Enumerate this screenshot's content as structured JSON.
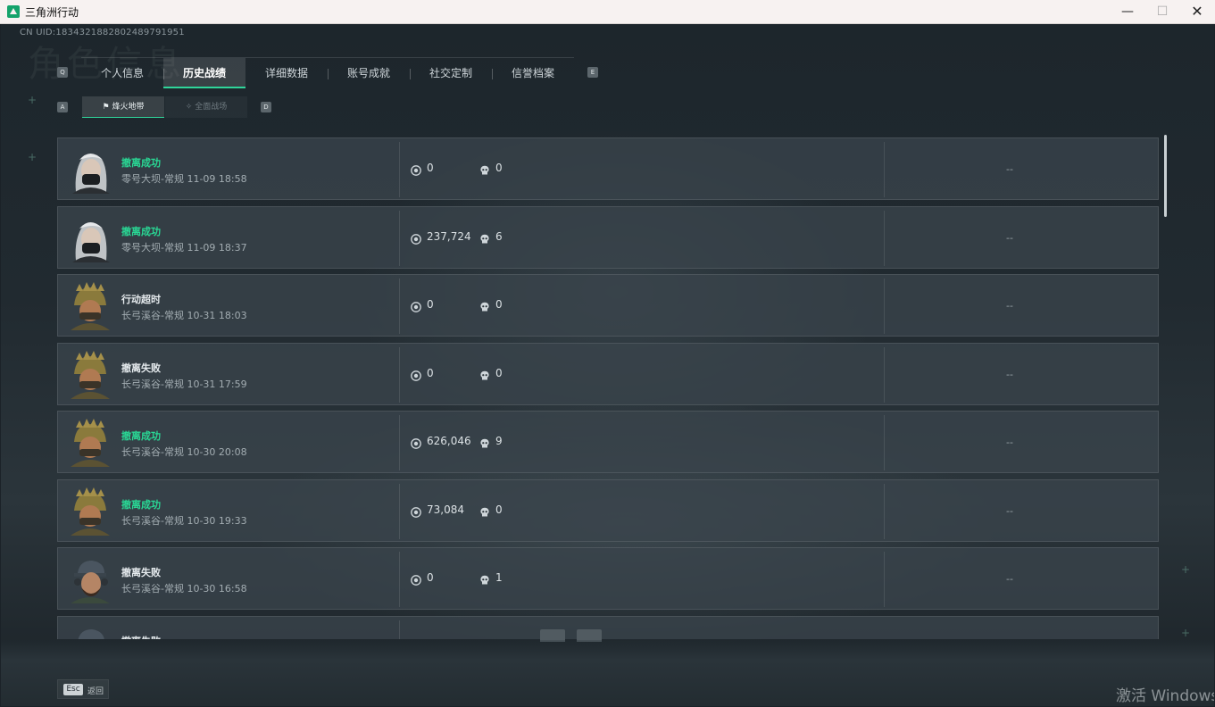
{
  "window": {
    "title": "三角洲行动",
    "controls": {
      "minimize": "—",
      "maximize": "☐",
      "close": "✕"
    }
  },
  "header": {
    "uid": "CN UID:1834321882802489791951",
    "watermark": "角色信息"
  },
  "tabs": {
    "left_key": "Q",
    "right_key": "E",
    "items": [
      {
        "label": "个人信息"
      },
      {
        "label": "历史战绩",
        "active": true
      },
      {
        "label": "详细数据"
      },
      {
        "label": "账号成就"
      },
      {
        "label": "社交定制"
      },
      {
        "label": "信誉档案"
      }
    ]
  },
  "subtabs": {
    "left_key": "A",
    "right_key": "D",
    "items": [
      {
        "label": "烽火地带",
        "active": true
      },
      {
        "label": "全面战场",
        "active": false
      }
    ]
  },
  "matches": [
    {
      "result": "撤离成功",
      "status": "success",
      "map": "零号大坝-常规 11-09 18:58",
      "value": "0",
      "kills": "0",
      "extra": "--",
      "avatar": "female-mask"
    },
    {
      "result": "撤离成功",
      "status": "success",
      "map": "零号大坝-常规 11-09 18:37",
      "value": "237,724",
      "kills": "6",
      "extra": "--",
      "avatar": "female-mask"
    },
    {
      "result": "行动超时",
      "status": "neutral",
      "map": "长弓溪谷-常规 10-31 18:03",
      "value": "0",
      "kills": "0",
      "extra": "--",
      "avatar": "gold-helmet"
    },
    {
      "result": "撤离失败",
      "status": "fail",
      "map": "长弓溪谷-常规 10-31 17:59",
      "value": "0",
      "kills": "0",
      "extra": "--",
      "avatar": "gold-helmet"
    },
    {
      "result": "撤离成功",
      "status": "success",
      "map": "长弓溪谷-常规 10-30 20:08",
      "value": "626,046",
      "kills": "9",
      "extra": "--",
      "avatar": "gold-helmet"
    },
    {
      "result": "撤离成功",
      "status": "success",
      "map": "长弓溪谷-常规 10-30 19:33",
      "value": "73,084",
      "kills": "0",
      "extra": "--",
      "avatar": "gold-helmet"
    },
    {
      "result": "撤离失败",
      "status": "fail",
      "map": "长弓溪谷-常规 10-30 16:58",
      "value": "0",
      "kills": "1",
      "extra": "--",
      "avatar": "cap-headset"
    },
    {
      "result": "撤离失败",
      "status": "fail",
      "map": "",
      "value": "",
      "kills": "",
      "extra": "",
      "avatar": "cap-headset"
    }
  ],
  "footer": {
    "esc_key": "Esc",
    "back_label": "返回",
    "activate_text": "激活 Windows"
  },
  "icons": {
    "value": "coin-icon",
    "kills": "skull-icon"
  },
  "colors": {
    "success": "#29d895",
    "accent": "#2fd59a",
    "panel": "#3a444c"
  }
}
